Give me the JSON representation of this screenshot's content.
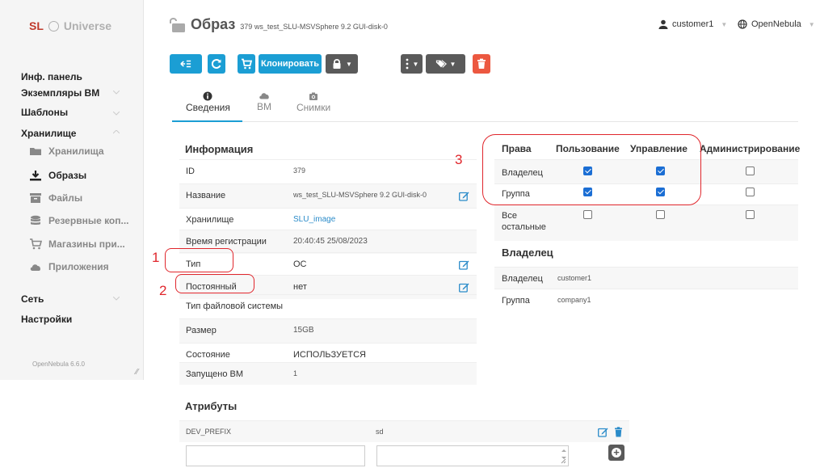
{
  "sidebar": {
    "logo_prefix": "SL",
    "logo_name": "Universe",
    "items": [
      {
        "label": "Инф. панель"
      },
      {
        "label": "Экземпляры ВМ"
      },
      {
        "label": "Шаблоны"
      },
      {
        "label": "Хранилище"
      }
    ],
    "storage_sub": [
      {
        "label": "Хранилища",
        "icon": "folder-icon"
      },
      {
        "label": "Образы",
        "icon": "download-icon"
      },
      {
        "label": "Файлы",
        "icon": "archive-icon"
      },
      {
        "label": "Резервные коп...",
        "icon": "database-icon"
      },
      {
        "label": "Магазины при...",
        "icon": "cart-icon"
      },
      {
        "label": "Приложения",
        "icon": "cloud-icon"
      }
    ],
    "network": "Сеть",
    "settings": "Настройки",
    "version": "OpenNebula 6.6.0"
  },
  "header": {
    "title": "Образ",
    "subtitle": "379 ws_test_SLU-MSVSphere 9.2 GUI-disk-0",
    "user": "customer1",
    "zone": "OpenNebula"
  },
  "toolbar": {
    "clone_label": "Клонировать"
  },
  "tabs": [
    {
      "label": "Сведения"
    },
    {
      "label": "ВМ"
    },
    {
      "label": "Снимки"
    }
  ],
  "info": {
    "title": "Информация",
    "rows": [
      {
        "key": "ID",
        "value": "379"
      },
      {
        "key": "Название",
        "value": "ws_test_SLU-MSVSphere 9.2 GUI-disk-0"
      },
      {
        "key": "Хранилище",
        "value": "SLU_image"
      },
      {
        "key": "Время регистрации",
        "value": "20:40:45 25/08/2023"
      },
      {
        "key": "Тип",
        "value": "ОС"
      },
      {
        "key": "Постоянный",
        "value": "нет"
      },
      {
        "key": "Тип файловой системы",
        "value": ""
      },
      {
        "key": "Размер",
        "value": "15GB"
      },
      {
        "key": "Состояние",
        "value": "ИСПОЛЬЗУЕТСЯ"
      },
      {
        "key": "Запущено ВМ",
        "value": "1"
      }
    ]
  },
  "permissions": {
    "headers": [
      "Права",
      "Пользование",
      "Управление",
      "Администрирование"
    ],
    "rows": [
      {
        "label": "Владелец",
        "use": true,
        "manage": true,
        "admin": false
      },
      {
        "label": "Группа",
        "use": true,
        "manage": true,
        "admin": false
      },
      {
        "label": "Все остальные",
        "use": false,
        "manage": false,
        "admin": false
      }
    ]
  },
  "ownership": {
    "title": "Владелец",
    "rows": [
      {
        "key": "Владелец",
        "value": "customer1"
      },
      {
        "key": "Группа",
        "value": "company1"
      }
    ]
  },
  "attributes": {
    "title": "Атрибуты",
    "rows": [
      {
        "key": "DEV_PREFIX",
        "value": "sd"
      }
    ]
  },
  "annotations": [
    "1",
    "2",
    "3"
  ],
  "colors": {
    "accent": "#1b9ed4",
    "danger": "#ec5840",
    "annotation": "#e0262c"
  }
}
